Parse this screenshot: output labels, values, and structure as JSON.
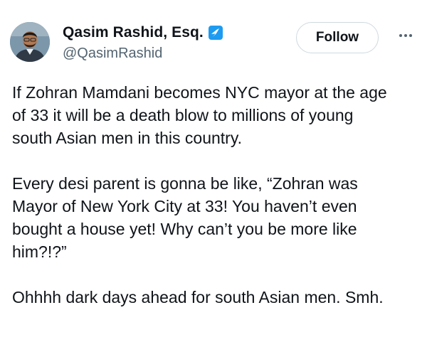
{
  "author": {
    "display_name": "Qasim Rashid, Esq.",
    "handle": "@QasimRashid",
    "verified_icon": "verified-badge-icon",
    "verified_color": "#1d9bf0"
  },
  "actions": {
    "follow_label": "Follow",
    "more_icon": "more-options-icon"
  },
  "tweet": {
    "paragraphs": [
      "If Zohran Mamdani becomes NYC mayor at the age\nof 33 it will be a death blow to millions of young\nsouth Asian men in this country.",
      "Every desi parent is gonna be like, “Zohran was\nMayor of New York City at 33! You haven’t even\nbought a house yet! Why can’t you be more like\nhim?!?”",
      "Ohhhh dark days ahead for south Asian men. Smh."
    ]
  }
}
